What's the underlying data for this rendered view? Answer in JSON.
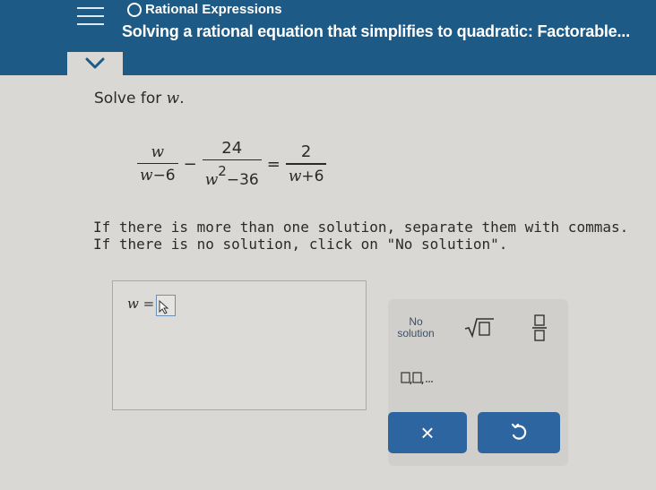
{
  "header": {
    "topic": "Rational Expressions",
    "lesson": "Solving a rational equation that simplifies to quadratic: Factorable..."
  },
  "problem": {
    "prompt_text": "Solve for ",
    "variable": "w",
    "equation": {
      "frac1_num": "w",
      "frac1_den_var": "w",
      "frac1_den_rest": "−6",
      "minus": "−",
      "frac2_num": "24",
      "frac2_den_var": "w",
      "frac2_den_exp": "2",
      "frac2_den_rest": "−36",
      "equals": "=",
      "frac3_num": "2",
      "frac3_den_var": "w",
      "frac3_den_rest": "+6"
    },
    "instruction_line1": "If there is more than one solution, separate them with commas.",
    "instruction_line2": "If there is no solution, click on \"No solution\"."
  },
  "answer": {
    "label_var": "w",
    "label_eq": " =",
    "value": ""
  },
  "palette": {
    "no_solution_line1": "No",
    "no_solution_line2": "solution",
    "clear_label": "×",
    "colors": {
      "accent": "#2c65a0",
      "header": "#1d5a86"
    }
  }
}
